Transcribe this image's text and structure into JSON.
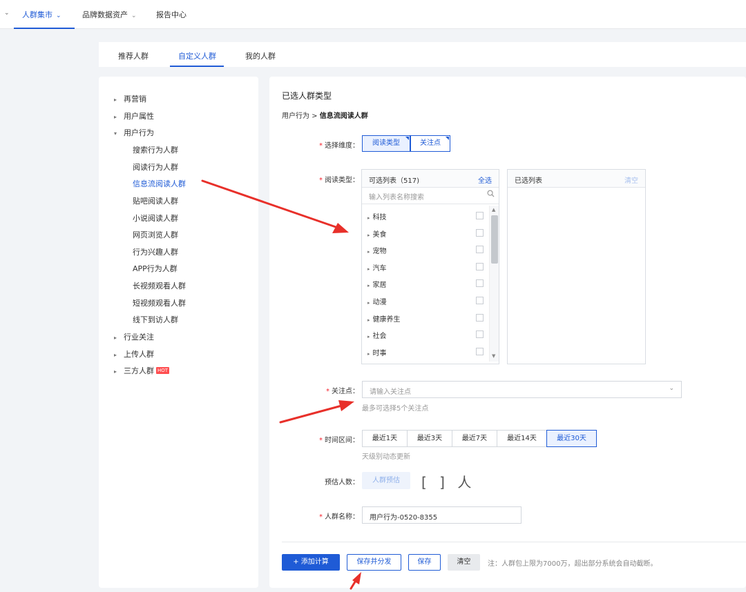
{
  "topnav": {
    "items": [
      {
        "label": "人群集市",
        "caret": "⌄"
      },
      {
        "label": "品牌数据资产",
        "caret": "⌄"
      },
      {
        "label": "报告中心"
      }
    ],
    "leading_caret": "⌄"
  },
  "subtabs": [
    "推荐人群",
    "自定义人群",
    "我的人群"
  ],
  "tree": {
    "groups": [
      {
        "label": "再营销",
        "expanded": false
      },
      {
        "label": "用户属性",
        "expanded": false
      },
      {
        "label": "用户行为",
        "expanded": true
      }
    ],
    "children": [
      "搜索行为人群",
      "阅读行为人群",
      "信息流阅读人群",
      "贴吧阅读人群",
      "小说阅读人群",
      "网页浏览人群",
      "行为兴趣人群",
      "APP行为人群",
      "长视频观看人群",
      "短视频观看人群",
      "线下到访人群"
    ],
    "groups_after": [
      {
        "label": "行业关注"
      },
      {
        "label": "上传人群"
      },
      {
        "label": "三方人群",
        "badge": "HOT"
      }
    ],
    "collapsed_icon": "▸",
    "expanded_icon": "▾"
  },
  "main": {
    "selected_title": "已选人群类型",
    "breadcrumb_parent": "用户行为 > ",
    "breadcrumb_current": "信息流阅读人群",
    "required_mark": "*",
    "dimension": {
      "label": "选择维度：",
      "options": [
        "阅读类型",
        "关注点"
      ]
    },
    "read_type": {
      "label": "阅读类型：",
      "available_title": "可选列表（517)",
      "select_all": "全选",
      "search_placeholder": "输入列表名称搜索",
      "search_icon": "search-icon",
      "items": [
        "科技",
        "美食",
        "宠物",
        "汽车",
        "家居",
        "动漫",
        "健康养生",
        "社会",
        "时事"
      ],
      "selected_title": "已选列表",
      "clear": "清空"
    },
    "focus": {
      "label": "关注点：",
      "placeholder": "请输入关注点",
      "hint": "最多可选择5个关注点",
      "chevron": "⌄"
    },
    "time": {
      "label": "时间区间：",
      "options": [
        "最近1天",
        "最近3天",
        "最近7天",
        "最近14天",
        "最近30天"
      ],
      "selected": "最近30天",
      "hint": "天级别动态更新"
    },
    "estimate": {
      "label": "预估人数：",
      "button": "人群预估",
      "result": "[ ] 人"
    },
    "name": {
      "label": "人群名称：",
      "value": "用户行为-0520-8355"
    },
    "actions": {
      "add_calc": "+ 添加计算",
      "save_distribute": "保存并分发",
      "save": "保存",
      "clear": "清空",
      "note": "注：人群包上限为7000万，超出部分系统会自动截断。"
    }
  },
  "colors": {
    "accent": "#1f5bd6",
    "annotation_arrow": "#e8302a",
    "hot_badge": "#ff4d4f"
  }
}
